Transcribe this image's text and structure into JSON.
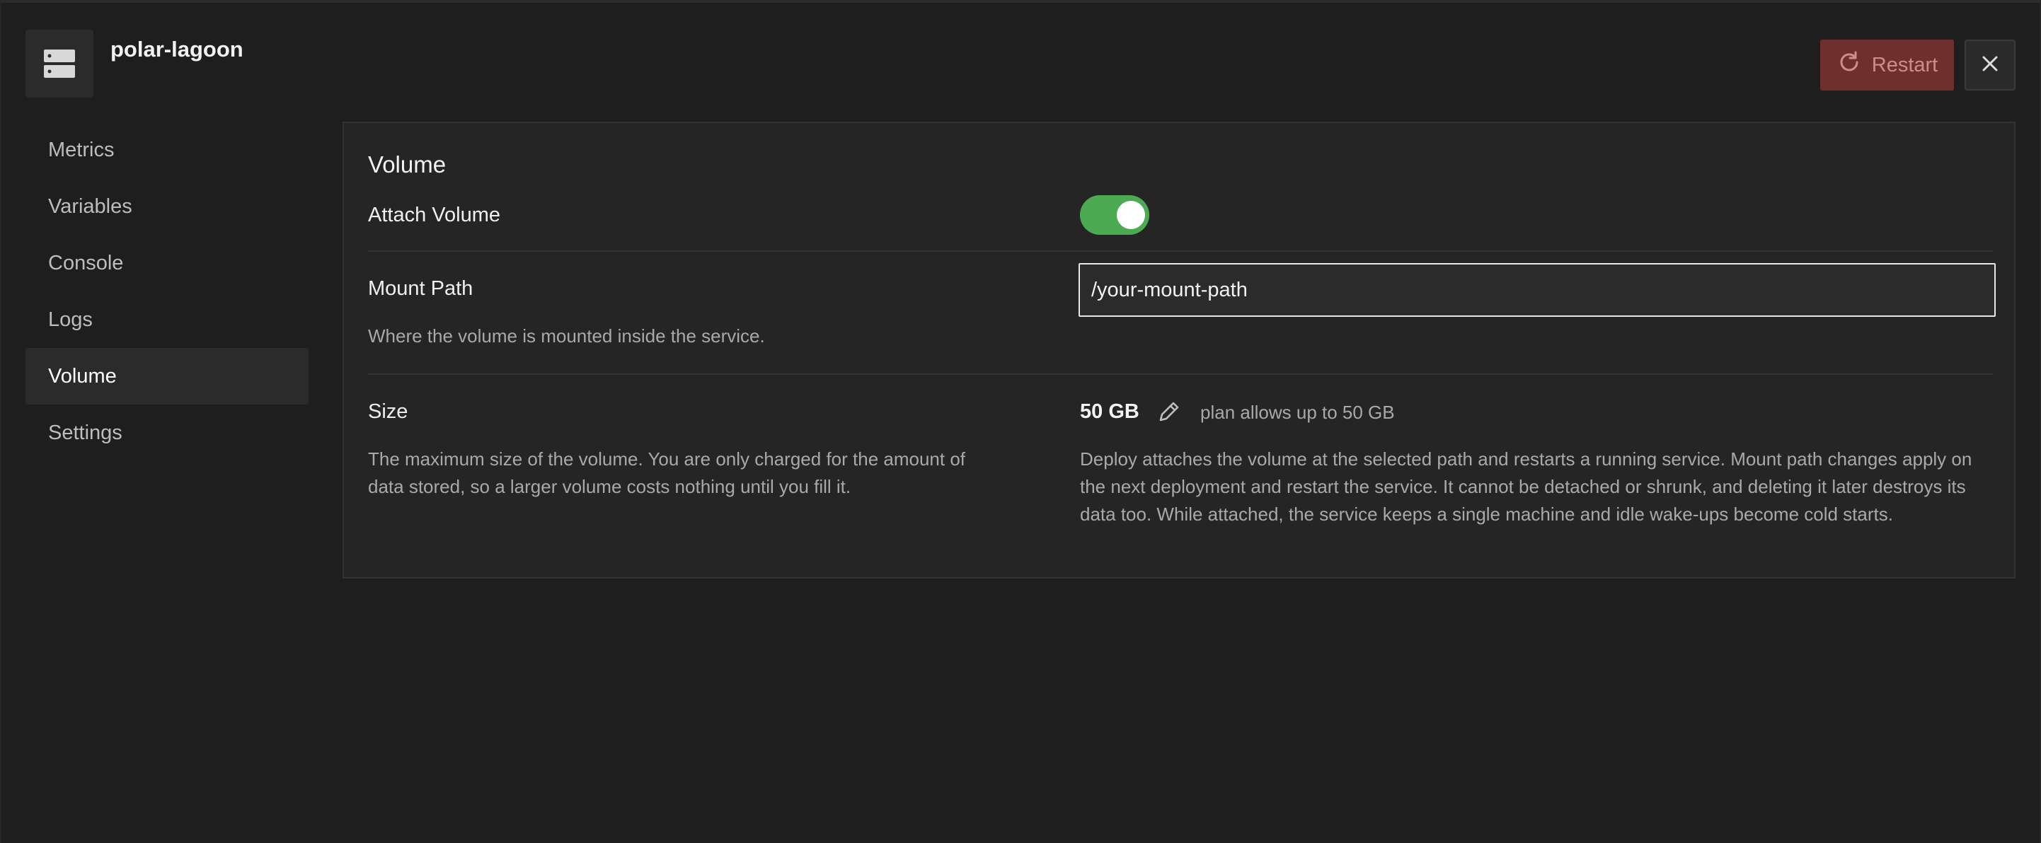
{
  "header": {
    "service_name": "polar-lagoon",
    "service_icon": "server-icon",
    "restart_label": "Restart",
    "restart_icon": "refresh-icon",
    "close_icon": "close-icon"
  },
  "sidebar": {
    "items": [
      {
        "label": "Metrics"
      },
      {
        "label": "Variables"
      },
      {
        "label": "Console"
      },
      {
        "label": "Logs"
      },
      {
        "label": "Volume",
        "active": true
      },
      {
        "label": "Settings"
      }
    ]
  },
  "volume": {
    "title": "Volume",
    "attach": {
      "label": "Attach Volume",
      "enabled": true
    },
    "mount": {
      "label": "Mount Path",
      "value": "/your-mount-path",
      "help": "Where the volume is mounted inside the service."
    },
    "size": {
      "label": "Size",
      "value": "50 GB",
      "edit_icon": "pencil-icon",
      "plan_note": "plan allows up to 50 GB",
      "help_line1": "The maximum size of the volume. You are only charged for the amount of",
      "help_line2": "data stored, so a larger volume costs nothing until you fill it.",
      "deploy_note": "Deploy attaches the volume at the selected path and restarts a running service. Mount path changes apply on the next deployment and restart the service. It cannot be detached or shrunk, and deleting it later destroys its data too. While attached, the service keeps a single machine and idle wake-ups become cold starts."
    }
  },
  "colors": {
    "background": "#1e1e1e",
    "panel": "#252525",
    "toggle_on": "#4caa52",
    "restart_bg": "#6e2f2d",
    "restart_text": "#c98f8b"
  }
}
